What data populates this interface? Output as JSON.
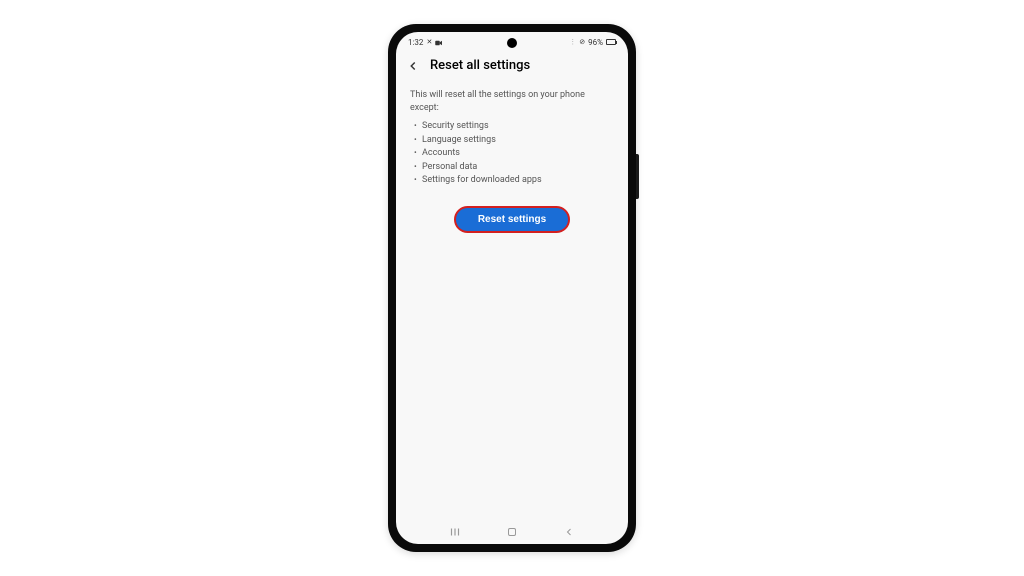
{
  "status_bar": {
    "time": "1:32",
    "battery_percent": "96%"
  },
  "header": {
    "title": "Reset all settings"
  },
  "content": {
    "description": "This will reset all the settings on your phone except:",
    "exceptions": [
      "Security settings",
      "Language settings",
      "Accounts",
      "Personal data",
      "Settings for downloaded apps"
    ],
    "reset_button_label": "Reset settings"
  }
}
